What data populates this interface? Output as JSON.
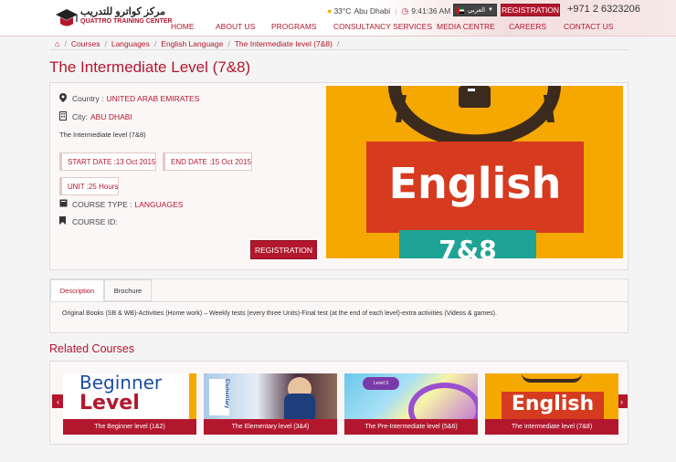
{
  "logo": {
    "arabic": "مركز كواترو للتدريب",
    "english": "QUATTRO TRAINING CENTER"
  },
  "topbar": {
    "temperature": "33°C",
    "city": "Abu Dhabi",
    "time": "9:41:36 AM",
    "language": "العربي",
    "registration": "REGISTRATION",
    "phone": "+971 2 6323206"
  },
  "nav": [
    "HOME",
    "ABOUT US",
    "PROGRAMS",
    "CONSULTANCY SERVICES",
    "MEDIA CENTRE",
    "CAREERS",
    "CONTACT US"
  ],
  "breadcrumb": [
    "Courses",
    "Languages",
    "English Language",
    "The Intermediate level (7&8)"
  ],
  "page_title": "The Intermediate Level (7&8)",
  "course": {
    "country_label": "Country :",
    "country_value": "UNITED ARAB EMIRATES",
    "city_label": "City:",
    "city_value": "ABU DHABI",
    "subtitle": "The Intermediate level (7&8)",
    "start_date": "START DATE :13 Oct 2015",
    "end_date": "END DATE :15 Oct 2015",
    "unit": "UNIT :25 Hours",
    "course_type_label": "COURSE TYPE :",
    "course_type_value": "LANGUAGES",
    "course_id_label": "COURSE ID:",
    "register_button": "REGISTRATION",
    "hero_word": "English",
    "hero_number": "7&8"
  },
  "tabs": {
    "description": "Description",
    "brochure": "Brochure"
  },
  "description_text": "Original Books (SB & WB)-Activities (Home work) – Weekly tests (every three Units)-Final test (at the end of each level)-extra activities (Videos & games).",
  "related_heading": "Related Courses",
  "related": [
    {
      "caption": "The Beginner level (1&2)",
      "img_line1": "Beginner",
      "img_line2": "Level"
    },
    {
      "caption": "The Elementary level (3&4)",
      "img_text": "Elementary"
    },
    {
      "caption": "The Pre-Intermediate level (5&6)",
      "img_text": "Level 3"
    },
    {
      "caption": "The Intermediate level (7&8)",
      "img_text": "English"
    }
  ],
  "colors": {
    "brand": "#b3172e",
    "hero_bg": "#f5a800",
    "hero_box": "#d63a1f",
    "hero_teal": "#1fa396"
  },
  "icons": [
    "home-icon",
    "map-marker-icon",
    "building-icon",
    "book-icon",
    "bookmark-icon",
    "clock-icon",
    "sun-icon",
    "chevron-left-icon",
    "chevron-right-icon"
  ]
}
